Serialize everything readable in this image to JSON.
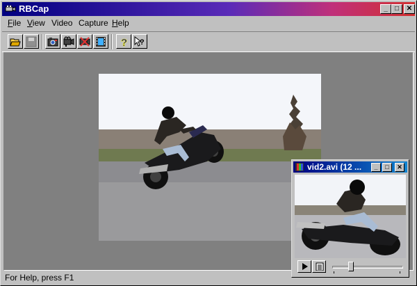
{
  "window": {
    "title": "RBCap"
  },
  "menu": [
    {
      "key": "F",
      "rest": "ile"
    },
    {
      "key": "V",
      "rest": "iew"
    },
    {
      "key": "",
      "rest": "Video"
    },
    {
      "key": "",
      "rest": "Capture"
    },
    {
      "key": "H",
      "rest": "elp"
    }
  ],
  "toolbar": {
    "buttons": [
      "open-icon",
      "save-icon",
      "snapshot-icon",
      "record-icon",
      "stop-icon",
      "film-icon",
      "help-icon",
      "context-help-icon"
    ]
  },
  "status": {
    "text": "For Help, press F1"
  },
  "child_window": {
    "title": "vid2.avi (12 ..."
  },
  "player": {
    "position": 0.25
  }
}
